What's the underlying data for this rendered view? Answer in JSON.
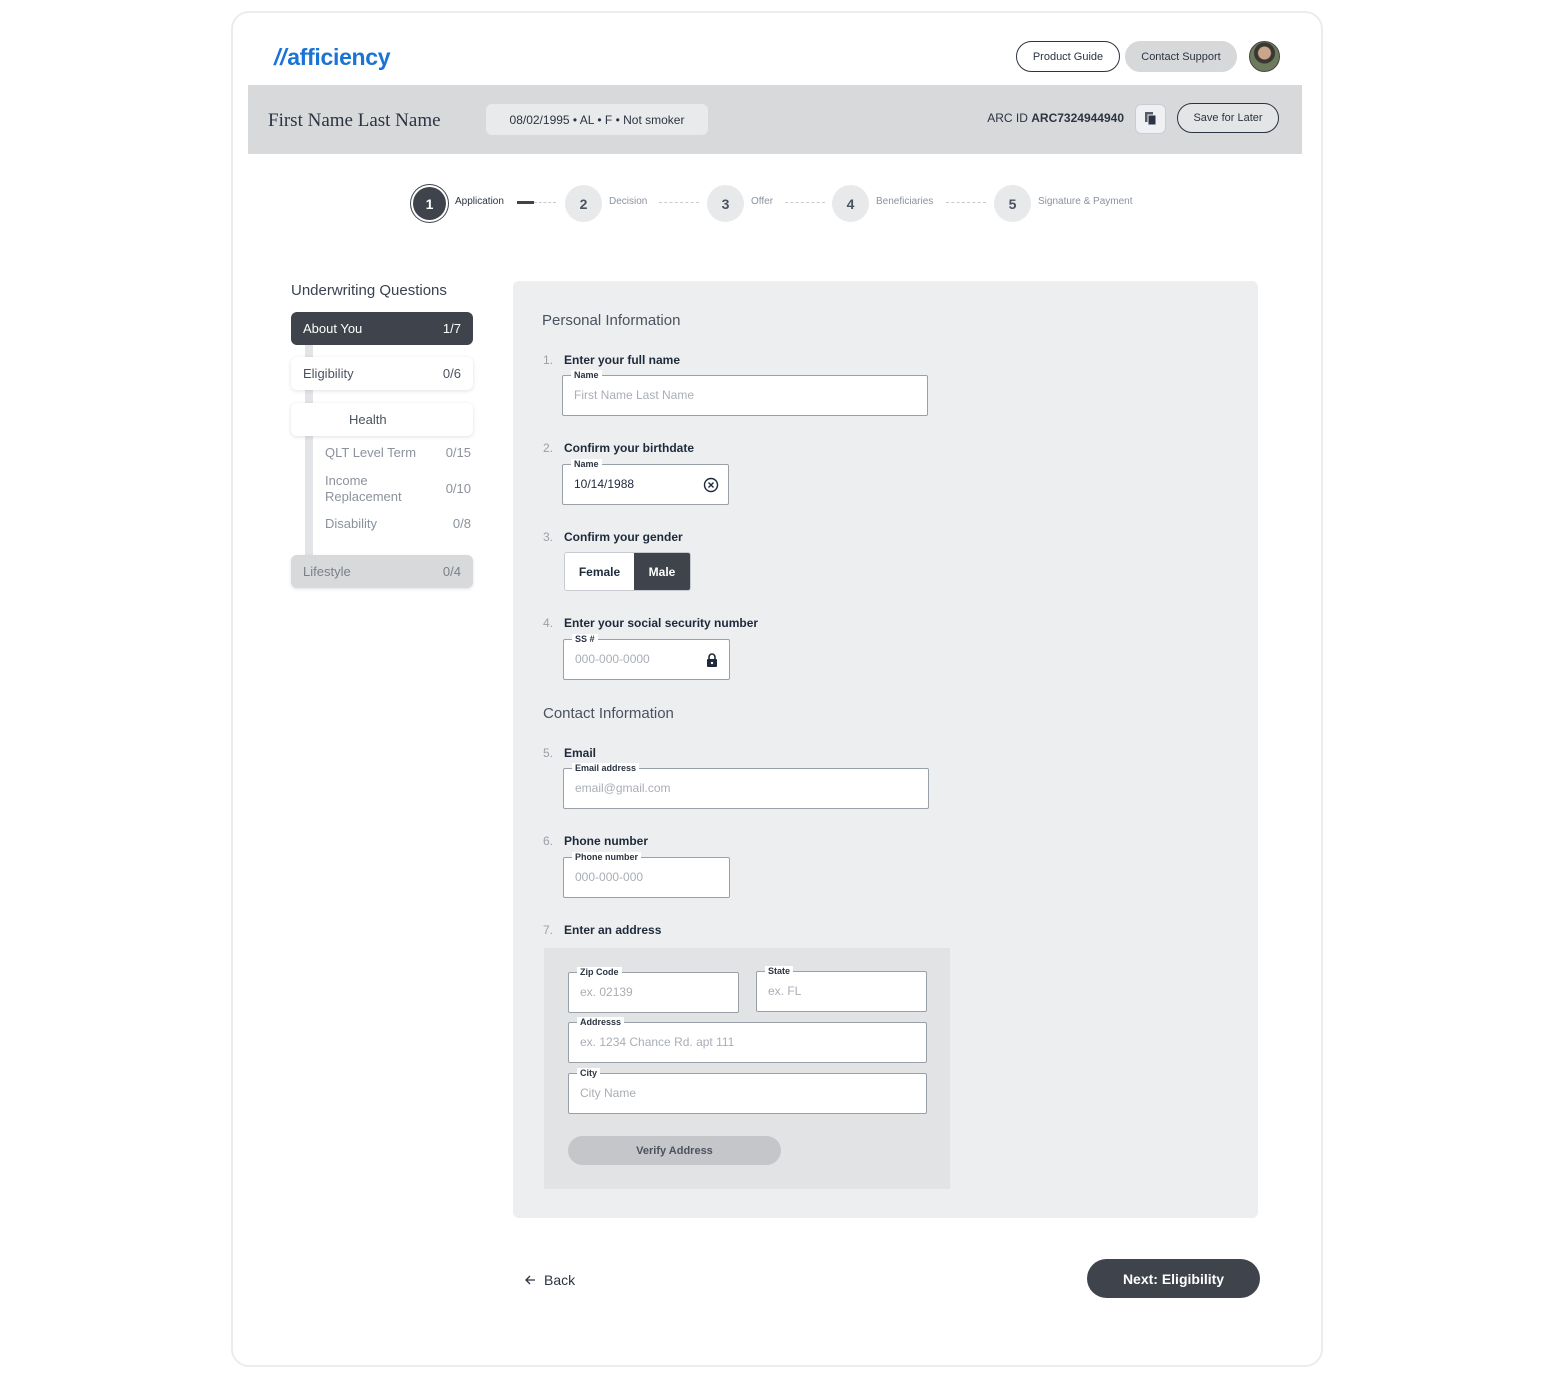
{
  "header": {
    "logo": "afficiency",
    "product_guide": "Product Guide",
    "contact_support": "Contact Support"
  },
  "applicant": {
    "name": "First Name Last Name",
    "meta": "08/02/1995  •  AL  •  F  •  Not smoker",
    "arc_label": "ARC ID",
    "arc_id": "ARC7324944940",
    "save_label": "Save for Later"
  },
  "steps": [
    {
      "num": "1",
      "label": "Application",
      "active": true
    },
    {
      "num": "2",
      "label": "Decision"
    },
    {
      "num": "3",
      "label": "Offer"
    },
    {
      "num": "4",
      "label": "Beneficiaries"
    },
    {
      "num": "5",
      "label": "Signature & Payment"
    }
  ],
  "sidebar": {
    "title": "Underwriting Questions",
    "about": {
      "label": "About You",
      "count": "1/7"
    },
    "eligibility": {
      "label": "Eligibility",
      "count": "0/6"
    },
    "health": {
      "label": "Health"
    },
    "health_items": [
      {
        "label": "QLT Level Term",
        "count": "0/15"
      },
      {
        "label": "Income Replacement",
        "count": "0/10"
      },
      {
        "label": "Disability",
        "count": "0/8"
      }
    ],
    "lifestyle": {
      "label": "Lifestyle",
      "count": "0/4"
    }
  },
  "form": {
    "personal_title": "Personal Information",
    "contact_title": "Contact Information",
    "q1": {
      "num": "1.",
      "label": "Enter your full name",
      "field_label": "Name",
      "placeholder": "First Name Last Name"
    },
    "q2": {
      "num": "2.",
      "label": "Confirm your birthdate",
      "field_label": "Name",
      "value": "10/14/1988"
    },
    "q3": {
      "num": "3.",
      "label": "Confirm your gender",
      "female": "Female",
      "male": "Male",
      "selected": "Male"
    },
    "q4": {
      "num": "4.",
      "label": "Enter your social security number",
      "field_label": "SS #",
      "placeholder": "000-000-0000"
    },
    "q5": {
      "num": "5.",
      "label": "Email",
      "field_label": "Email address",
      "placeholder": "email@gmail.com"
    },
    "q6": {
      "num": "6.",
      "label": "Phone number",
      "field_label": "Phone number",
      "placeholder": "000-000-000"
    },
    "q7": {
      "num": "7.",
      "label": "Enter an address"
    },
    "address": {
      "zip_label": "Zip Code",
      "zip_placeholder": "ex. 02139",
      "state_label": "State",
      "state_placeholder": "ex. FL",
      "address_label": "Addresss",
      "address_placeholder": "ex. 1234 Chance Rd. apt 111",
      "city_label": "City",
      "city_placeholder": "City Name",
      "verify_label": "Verify Address"
    }
  },
  "footer": {
    "back_label": "Back",
    "next_label": "Next: Eligibility"
  },
  "colors": {
    "brand": "#1a73d6",
    "dark": "#3f434b",
    "panel": "#edeef0"
  }
}
